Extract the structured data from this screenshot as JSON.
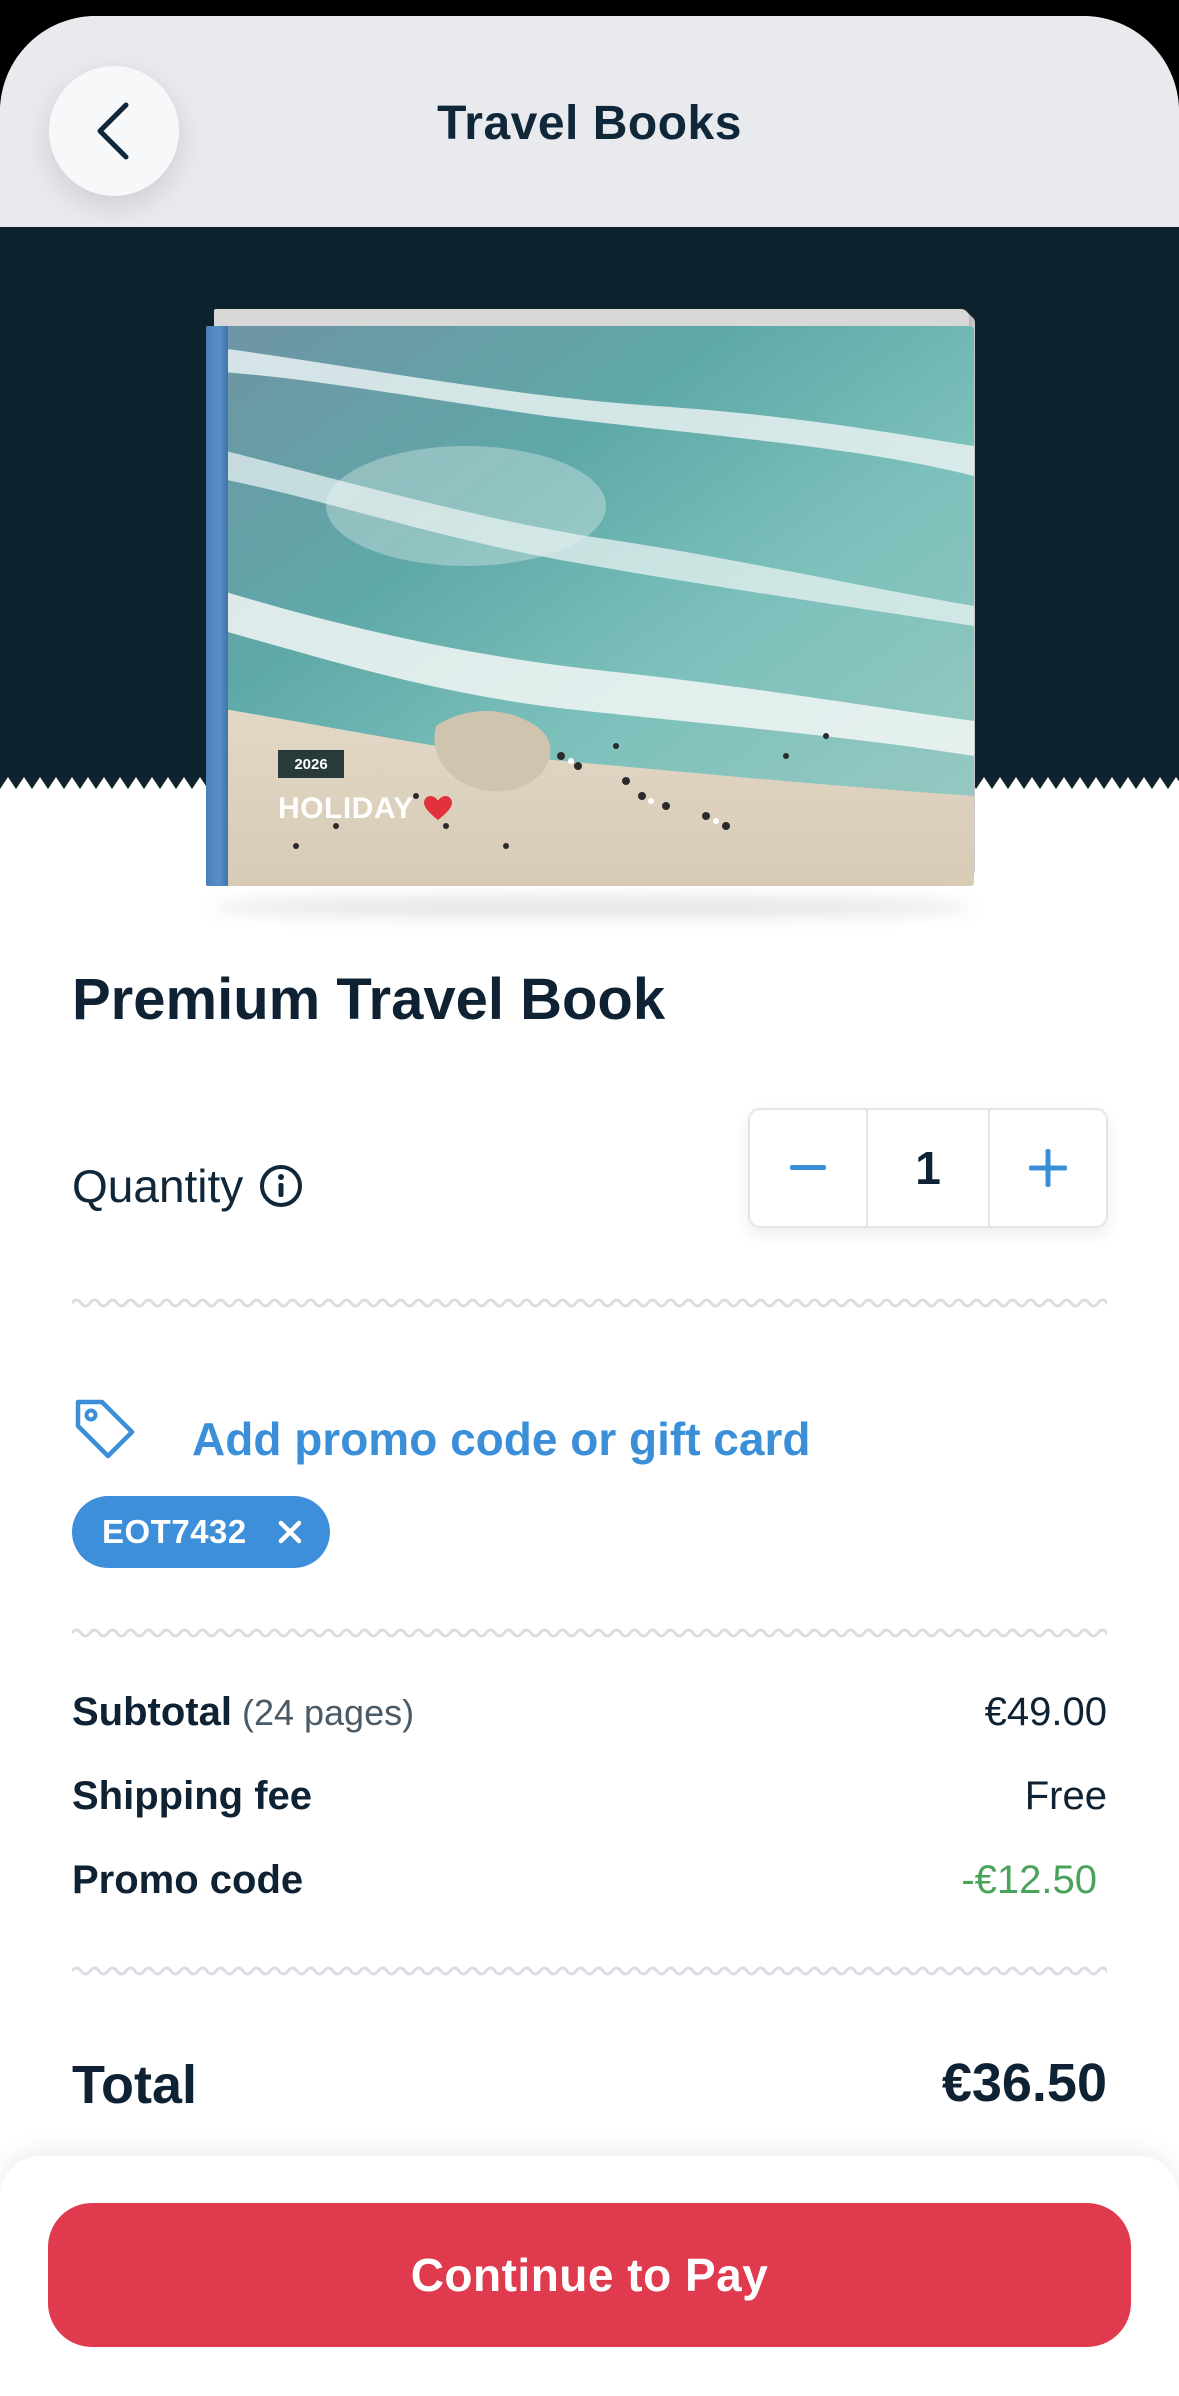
{
  "header": {
    "title": "Travel Books",
    "back_icon": "chevron-left-icon"
  },
  "book": {
    "year": "2026",
    "cover_title": "HOLIDAY",
    "heart_icon": "heart-icon"
  },
  "product": {
    "title": "Premium Travel Book"
  },
  "quantity": {
    "label": "Quantity",
    "value": "1",
    "info_icon": "info-icon",
    "minus_icon": "minus-icon",
    "plus_icon": "plus-icon"
  },
  "promo": {
    "link_label": "Add promo code or gift card",
    "tag_icon": "tag-icon",
    "applied_code": "EOT7432",
    "remove_icon": "close-icon"
  },
  "summary": {
    "subtotal_label": "Subtotal",
    "subtotal_note": "(24 pages)",
    "subtotal_value": "€49.00",
    "shipping_label": "Shipping fee",
    "shipping_value": "Free",
    "promo_label": "Promo code",
    "promo_value": "-€12.50",
    "total_label": "Total",
    "total_value": "€36.50"
  },
  "footer": {
    "pay_label": "Continue to Pay"
  },
  "colors": {
    "accent_blue": "#3b8fd8",
    "discount_green": "#4aa35a",
    "pay_red": "#df3a4d",
    "hero_dark": "#0d222c"
  }
}
